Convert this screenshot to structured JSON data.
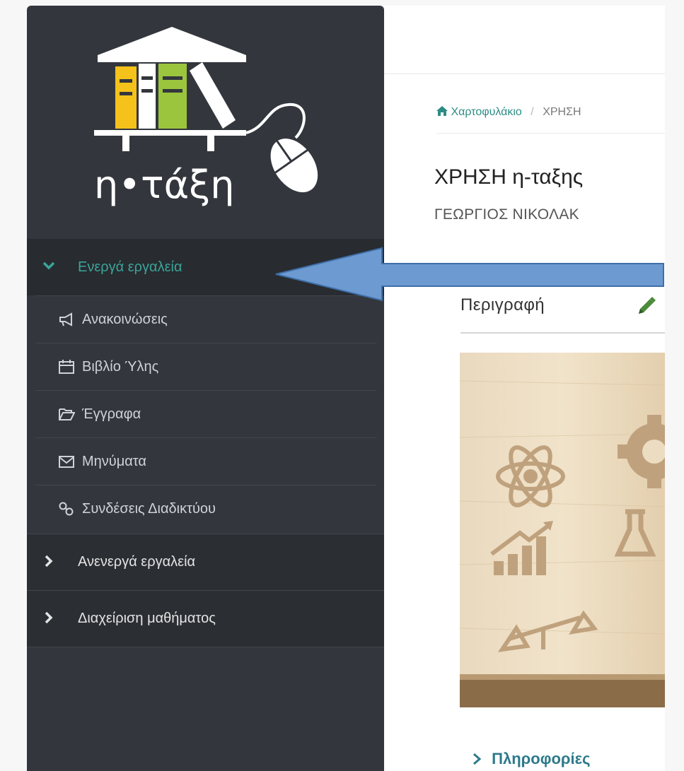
{
  "breadcrumb": {
    "home": "Χαρτοφυλάκιο",
    "separator": "/",
    "current": "ΧΡΗΣΗ"
  },
  "course": {
    "title": "ΧΡΗΣΗ η-ταξης",
    "teacher": "ΓΕΩΡΓΙΟΣ ΝΙΚΟΛΑΚ"
  },
  "description": {
    "heading": "Περιγραφή"
  },
  "info_link": "Πληροφορίες",
  "logo": {
    "wordmark": "η•τάξη"
  },
  "sidebar": {
    "active_section": "Ενεργά εργαλεία",
    "items": [
      {
        "label": "Ανακοινώσεις",
        "icon": "megaphone-icon"
      },
      {
        "label": "Βιβλίο Ύλης",
        "icon": "calendar-icon"
      },
      {
        "label": "Έγγραφα",
        "icon": "folder-open-icon"
      },
      {
        "label": "Μηνύματα",
        "icon": "envelope-icon"
      },
      {
        "label": "Συνδέσεις Διαδικτύου",
        "icon": "link-icon"
      }
    ],
    "inactive_sections": [
      {
        "label": "Ανενεργά εργαλεία"
      },
      {
        "label": "Διαχείριση μαθήματος"
      }
    ]
  },
  "colors": {
    "sidebar_bg": "#33373d",
    "accent_teal": "#3aa59a",
    "arrow_blue": "#6d9bd1",
    "logo_yellow": "#f5c21b",
    "logo_green": "#9bc53d"
  }
}
